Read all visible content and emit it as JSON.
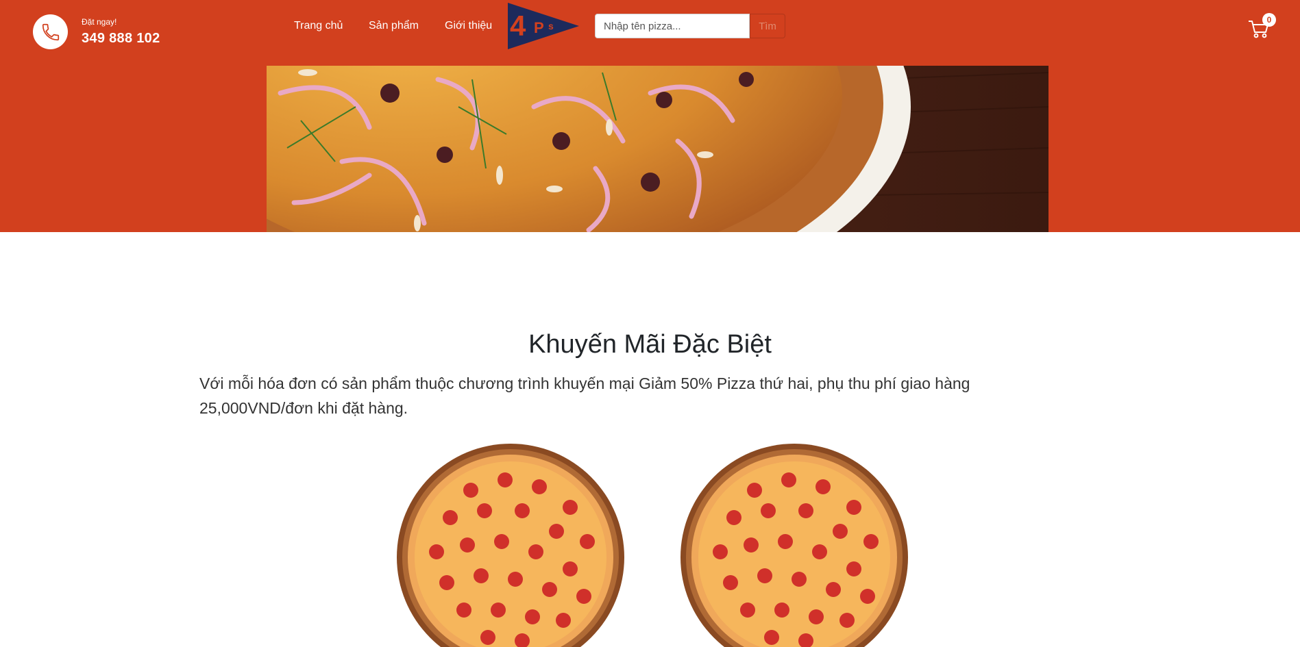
{
  "header": {
    "order_small": "Đặt ngay!",
    "order_phone": "349 888 102",
    "bg_color": "#d2401e"
  },
  "nav": {
    "home": "Trang chủ",
    "products": "Sản phẩm",
    "about": "Giới thiệu"
  },
  "logo": {
    "text_big": "4",
    "text_p": "P",
    "text_s": "s"
  },
  "search": {
    "placeholder": "Nhập tên pizza...",
    "button": "Tìm"
  },
  "cart": {
    "count": "0"
  },
  "promo": {
    "title": "Khuyến Mãi Đặc Biệt",
    "text": "Với mỗi hóa đơn có sản phẩm thuộc chương trình khuyến mại Giảm 50% Pizza thứ hai, phụ thu phí giao hàng 25,000VND/đơn khi đặt hàng."
  },
  "icons": [
    "phone-icon",
    "cart-icon"
  ]
}
